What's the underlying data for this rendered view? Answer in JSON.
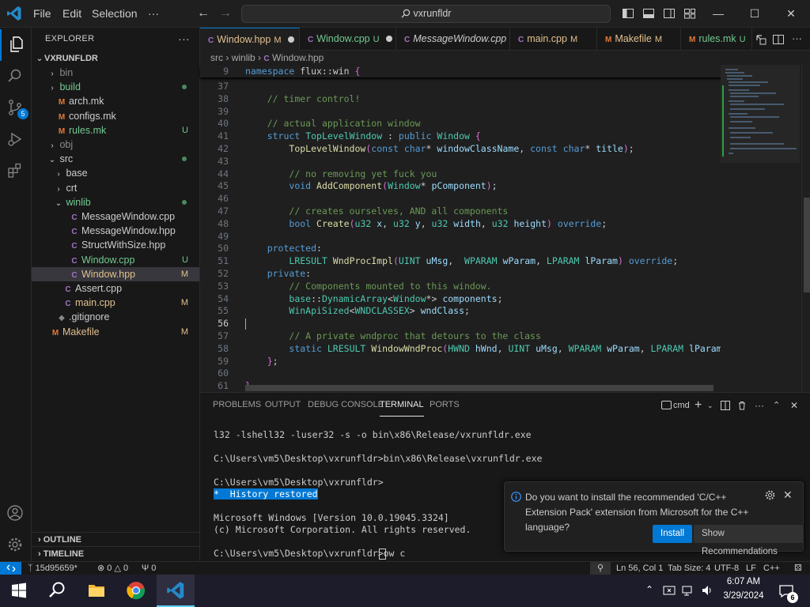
{
  "titlebar": {
    "menus": [
      "File",
      "Edit",
      "Selection",
      "···"
    ],
    "search_text": "vxrunfldr",
    "minimize": "—",
    "maximize": "☐",
    "close": "✕"
  },
  "activity": {
    "source_control_badge": "5"
  },
  "explorer": {
    "title": "EXPLORER",
    "more": "···",
    "root": "VXRUNFLDR",
    "items": [
      {
        "label": "bin",
        "kind": "folder",
        "depth": 1,
        "open": false,
        "color": "ignored",
        "deco": ""
      },
      {
        "label": "build",
        "kind": "folder",
        "depth": 1,
        "open": false,
        "color": "green",
        "deco": "dot"
      },
      {
        "label": "arch.mk",
        "kind": "file",
        "icon": "M",
        "depth": 1,
        "color": "plain",
        "deco": ""
      },
      {
        "label": "configs.mk",
        "kind": "file",
        "icon": "M",
        "depth": 1,
        "color": "plain",
        "deco": ""
      },
      {
        "label": "rules.mk",
        "kind": "file",
        "icon": "M",
        "depth": 1,
        "color": "untracked",
        "deco": "U"
      },
      {
        "label": "obj",
        "kind": "folder",
        "depth": 1,
        "open": false,
        "color": "ignored",
        "deco": ""
      },
      {
        "label": "src",
        "kind": "folder",
        "depth": 1,
        "open": true,
        "color": "plain",
        "deco": "dot"
      },
      {
        "label": "base",
        "kind": "folder",
        "depth": 2,
        "open": false,
        "color": "plain",
        "deco": ""
      },
      {
        "label": "crt",
        "kind": "folder",
        "depth": 2,
        "open": false,
        "color": "plain",
        "deco": ""
      },
      {
        "label": "winlib",
        "kind": "folder",
        "depth": 2,
        "open": true,
        "color": "green",
        "deco": "dot"
      },
      {
        "label": "MessageWindow.cpp",
        "kind": "file",
        "icon": "C",
        "depth": 3,
        "color": "plain",
        "deco": ""
      },
      {
        "label": "MessageWindow.hpp",
        "kind": "file",
        "icon": "C",
        "depth": 3,
        "color": "plain",
        "deco": ""
      },
      {
        "label": "StructWithSize.hpp",
        "kind": "file",
        "icon": "C",
        "depth": 3,
        "color": "plain",
        "deco": ""
      },
      {
        "label": "Window.cpp",
        "kind": "file",
        "icon": "C",
        "depth": 3,
        "color": "untracked",
        "deco": "U"
      },
      {
        "label": "Window.hpp",
        "kind": "file",
        "icon": "C",
        "depth": 3,
        "color": "mod",
        "deco": "M",
        "selected": true
      },
      {
        "label": "Assert.cpp",
        "kind": "file",
        "icon": "C",
        "depth": 2,
        "color": "plain",
        "deco": ""
      },
      {
        "label": "main.cpp",
        "kind": "file",
        "icon": "C",
        "depth": 2,
        "color": "mod",
        "deco": "M"
      },
      {
        "label": ".gitignore",
        "kind": "file",
        "icon": "",
        "depth": 1,
        "color": "plain",
        "deco": ""
      },
      {
        "label": "Makefile",
        "kind": "file",
        "icon": "M",
        "depth": 0,
        "color": "mod",
        "deco": "M"
      }
    ],
    "outline": "OUTLINE",
    "timeline": "TIMELINE"
  },
  "tabs": [
    {
      "icon": "C",
      "label": "Window.hpp",
      "status": "M",
      "dot": true,
      "active": true
    },
    {
      "icon": "C",
      "label": "Window.cpp",
      "status": "U",
      "dot": true,
      "active": false
    },
    {
      "icon": "C",
      "label": "MessageWindow.cpp",
      "status": "",
      "dot": false,
      "active": false
    },
    {
      "icon": "C",
      "label": "main.cpp",
      "status": "M",
      "dot": false,
      "active": false
    },
    {
      "icon": "M",
      "label": "Makefile",
      "status": "M",
      "dot": false,
      "active": false
    },
    {
      "icon": "M",
      "label": "rules.mk",
      "status": "U",
      "dot": false,
      "active": false
    }
  ],
  "breadcrumb": [
    "src",
    "winlib",
    "Window.hpp"
  ],
  "sticky_line": {
    "num": "9",
    "tokens": [
      [
        "kw",
        "namespace"
      ],
      [
        "",
        " flux::win "
      ],
      [
        "br",
        "{"
      ]
    ]
  },
  "code_lines": [
    {
      "num": "37",
      "tokens": []
    },
    {
      "num": "38",
      "tokens": [
        [
          "",
          "    "
        ],
        [
          "cm",
          "// timer control!"
        ]
      ]
    },
    {
      "num": "39",
      "tokens": []
    },
    {
      "num": "40",
      "tokens": [
        [
          "",
          "    "
        ],
        [
          "cm",
          "// actual application window"
        ]
      ]
    },
    {
      "num": "41",
      "tokens": [
        [
          "",
          "    "
        ],
        [
          "kw",
          "struct"
        ],
        [
          "",
          " "
        ],
        [
          "ty",
          "TopLevelWindow"
        ],
        [
          "",
          " : "
        ],
        [
          "kw",
          "public"
        ],
        [
          "",
          " "
        ],
        [
          "ty",
          "Window"
        ],
        [
          "",
          " "
        ],
        [
          "br",
          "{"
        ]
      ]
    },
    {
      "num": "42",
      "tokens": [
        [
          "",
          "        "
        ],
        [
          "fn",
          "TopLevelWindow"
        ],
        [
          "br",
          "("
        ],
        [
          "kw",
          "const"
        ],
        [
          "",
          " "
        ],
        [
          "kw",
          "char"
        ],
        [
          "",
          "* "
        ],
        [
          "va",
          "windowClassName"
        ],
        [
          "",
          ", "
        ],
        [
          "kw",
          "const"
        ],
        [
          "",
          " "
        ],
        [
          "kw",
          "char"
        ],
        [
          "",
          "* "
        ],
        [
          "va",
          "title"
        ],
        [
          "br",
          ")"
        ],
        [
          "",
          ";"
        ]
      ]
    },
    {
      "num": "43",
      "tokens": []
    },
    {
      "num": "44",
      "tokens": [
        [
          "",
          "        "
        ],
        [
          "cm",
          "// no removing yet fuck you"
        ]
      ]
    },
    {
      "num": "45",
      "tokens": [
        [
          "",
          "        "
        ],
        [
          "kw",
          "void"
        ],
        [
          "",
          " "
        ],
        [
          "fn",
          "AddComponent"
        ],
        [
          "br",
          "("
        ],
        [
          "ty",
          "Window"
        ],
        [
          "",
          "* "
        ],
        [
          "va",
          "pComponent"
        ],
        [
          "br",
          ")"
        ],
        [
          "",
          ";"
        ]
      ]
    },
    {
      "num": "46",
      "tokens": []
    },
    {
      "num": "47",
      "tokens": [
        [
          "",
          "        "
        ],
        [
          "cm",
          "// creates ourselves, AND all components"
        ]
      ]
    },
    {
      "num": "48",
      "tokens": [
        [
          "",
          "        "
        ],
        [
          "kw",
          "bool"
        ],
        [
          "",
          " "
        ],
        [
          "fn",
          "Create"
        ],
        [
          "br",
          "("
        ],
        [
          "ty",
          "u32"
        ],
        [
          "",
          " "
        ],
        [
          "va",
          "x"
        ],
        [
          "",
          ", "
        ],
        [
          "ty",
          "u32"
        ],
        [
          "",
          " "
        ],
        [
          "va",
          "y"
        ],
        [
          "",
          ", "
        ],
        [
          "ty",
          "u32"
        ],
        [
          "",
          " "
        ],
        [
          "va",
          "width"
        ],
        [
          "",
          ", "
        ],
        [
          "ty",
          "u32"
        ],
        [
          "",
          " "
        ],
        [
          "va",
          "height"
        ],
        [
          "br",
          ")"
        ],
        [
          "",
          " "
        ],
        [
          "kw",
          "override"
        ],
        [
          "",
          ";"
        ]
      ]
    },
    {
      "num": "49",
      "tokens": []
    },
    {
      "num": "50",
      "tokens": [
        [
          "",
          "    "
        ],
        [
          "kw",
          "protected"
        ],
        [
          "",
          ":"
        ]
      ]
    },
    {
      "num": "51",
      "tokens": [
        [
          "",
          "        "
        ],
        [
          "ty",
          "LRESULT"
        ],
        [
          "",
          " "
        ],
        [
          "fn",
          "WndProcImpl"
        ],
        [
          "br",
          "("
        ],
        [
          "ty",
          "UINT"
        ],
        [
          "",
          " "
        ],
        [
          "va",
          "uMsg"
        ],
        [
          "",
          ",  "
        ],
        [
          "ty",
          "WPARAM"
        ],
        [
          "",
          " "
        ],
        [
          "va",
          "wParam"
        ],
        [
          "",
          ", "
        ],
        [
          "ty",
          "LPARAM"
        ],
        [
          "",
          " "
        ],
        [
          "va",
          "lParam"
        ],
        [
          "br",
          ")"
        ],
        [
          "",
          " "
        ],
        [
          "kw",
          "override"
        ],
        [
          "",
          ";"
        ]
      ]
    },
    {
      "num": "52",
      "tokens": [
        [
          "",
          "    "
        ],
        [
          "kw",
          "private"
        ],
        [
          "",
          ":"
        ]
      ]
    },
    {
      "num": "53",
      "tokens": [
        [
          "",
          "        "
        ],
        [
          "cm",
          "// Components mounted to this window."
        ]
      ]
    },
    {
      "num": "54",
      "tokens": [
        [
          "",
          "        "
        ],
        [
          "ty",
          "base"
        ],
        [
          "",
          "::"
        ],
        [
          "ty",
          "DynamicArray"
        ],
        [
          "",
          "<"
        ],
        [
          "ty",
          "Window"
        ],
        [
          "",
          "*> "
        ],
        [
          "va",
          "components"
        ],
        [
          "",
          ";"
        ]
      ]
    },
    {
      "num": "55",
      "tokens": [
        [
          "",
          "        "
        ],
        [
          "ty",
          "WinApiSized"
        ],
        [
          "",
          "<"
        ],
        [
          "ty",
          "WNDCLASSEX"
        ],
        [
          "",
          "> "
        ],
        [
          "va",
          "wndClass"
        ],
        [
          "",
          ";"
        ]
      ]
    },
    {
      "num": "56",
      "tokens": [],
      "current": true
    },
    {
      "num": "57",
      "tokens": [
        [
          "",
          "        "
        ],
        [
          "cm",
          "// A private wndproc that detours to the class"
        ]
      ]
    },
    {
      "num": "58",
      "tokens": [
        [
          "",
          "        "
        ],
        [
          "kw",
          "static"
        ],
        [
          "",
          " "
        ],
        [
          "ty",
          "LRESULT"
        ],
        [
          "",
          " "
        ],
        [
          "fn",
          "WindowWndProc"
        ],
        [
          "br",
          "("
        ],
        [
          "ty",
          "HWND"
        ],
        [
          "",
          " "
        ],
        [
          "va",
          "hWnd"
        ],
        [
          "",
          ", "
        ],
        [
          "ty",
          "UINT"
        ],
        [
          "",
          " "
        ],
        [
          "va",
          "uMsg"
        ],
        [
          "",
          ", "
        ],
        [
          "ty",
          "WPARAM"
        ],
        [
          "",
          " "
        ],
        [
          "va",
          "wParam"
        ],
        [
          "",
          ", "
        ],
        [
          "ty",
          "LPARAM"
        ],
        [
          "",
          " "
        ],
        [
          "va",
          "lParam"
        ],
        [
          "br",
          ")"
        ],
        [
          "",
          ";"
        ]
      ]
    },
    {
      "num": "59",
      "tokens": [
        [
          "",
          "    "
        ],
        [
          "br",
          "}"
        ],
        [
          "",
          ";"
        ]
      ]
    },
    {
      "num": "60",
      "tokens": []
    },
    {
      "num": "61",
      "tokens": [
        [
          "br",
          "}"
        ]
      ]
    },
    {
      "num": "62",
      "tokens": []
    }
  ],
  "panel": {
    "tabs": [
      "PROBLEMS",
      "OUTPUT",
      "DEBUG CONSOLE",
      "TERMINAL",
      "PORTS"
    ],
    "active_tab": "TERMINAL",
    "shell": "cmd",
    "terminal": [
      {
        "text": "l32 -lshell32 -luser32 -s -o bin\\x86\\Release/vxrunfldr.exe"
      },
      {
        "text": ""
      },
      {
        "text": "C:\\Users\\vm5\\Desktop\\vxrunfldr>bin\\x86\\Release\\vxrunfldr.exe"
      },
      {
        "text": ""
      },
      {
        "text": "C:\\Users\\vm5\\Desktop\\vxrunfldr>"
      },
      {
        "text": "*  History restored",
        "history": true
      },
      {
        "text": ""
      },
      {
        "text": "Microsoft Windows [Version 10.0.19045.3324]"
      },
      {
        "text": "(c) Microsoft Corporation. All rights reserved."
      },
      {
        "text": ""
      },
      {
        "text": "C:\\Users\\vm5\\Desktop\\vxrunfldr>ow c"
      }
    ]
  },
  "notification": {
    "message": "Do you want to install the recommended 'C/C++ Extension Pack' extension from Microsoft for the C++ language?",
    "install": "Install",
    "recommendations": "Show Recommendations"
  },
  "statusbar": {
    "branch": "15d95659*",
    "errors": "0",
    "warnings": "0",
    "ports": "0",
    "position": "Ln 56, Col 1",
    "tab_size": "Tab Size: 4",
    "encoding": "UTF-8",
    "eol": "LF",
    "language": "C++"
  },
  "taskbar": {
    "time": "6:07 AM",
    "date": "3/29/2024",
    "notification_count": "6"
  },
  "colors": {
    "accent": "#0078d4",
    "modified": "#e2c08d",
    "untracked": "#73c991"
  }
}
